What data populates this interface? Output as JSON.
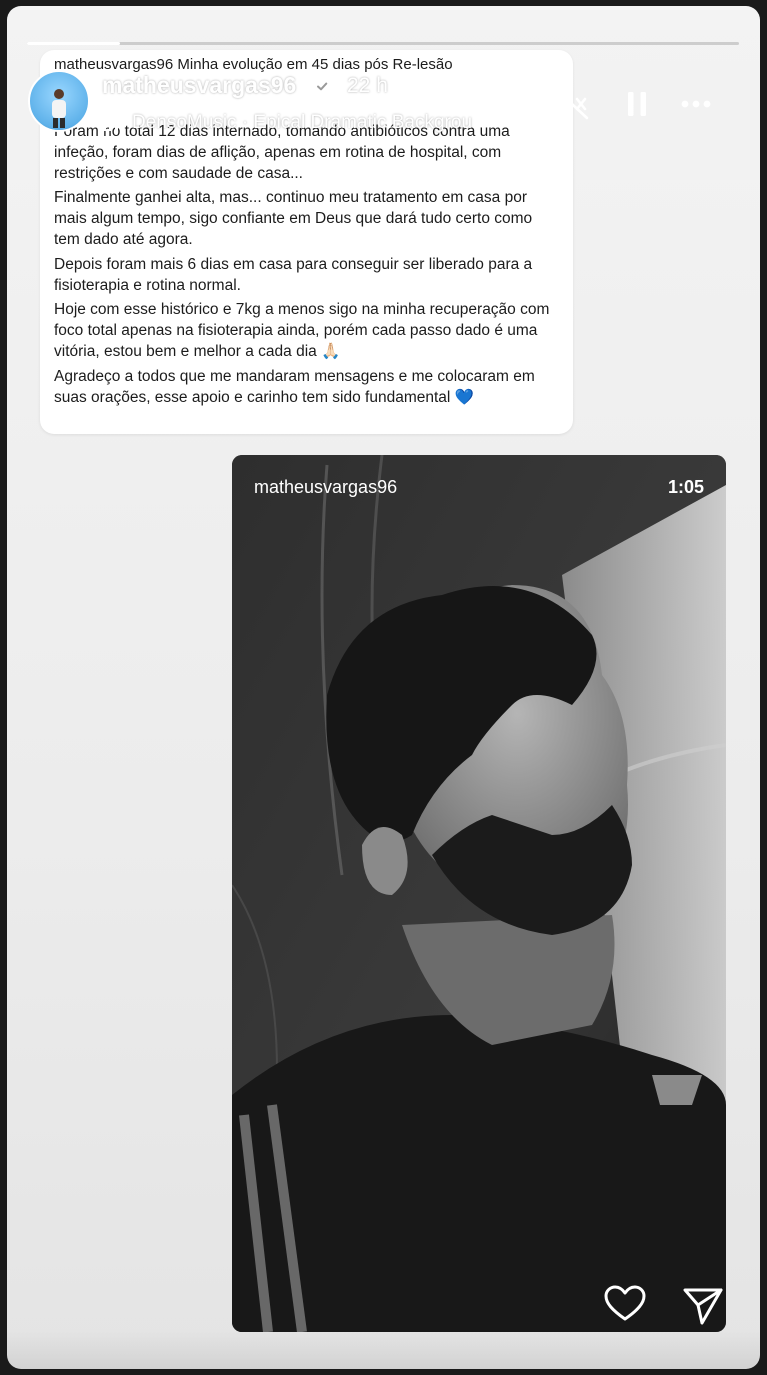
{
  "story": {
    "username": "matheusvargas96",
    "time_ago": "22 h",
    "music_track": "DensoMusic · Epical Dramatic Backgrou",
    "progress": 0.13
  },
  "caption": {
    "header_username": "matheusvargas96",
    "header_text": "Minha evolução em 45 dias pós Re-lesão",
    "paragraphs": [
      "Foram no total 12 dias internado, tomando antibióticos contra uma infeção, foram dias de aflição, apenas em rotina de hospital, com restrições e com saudade de casa...",
      "Finalmente ganhei alta, mas...  continuo meu tratamento em casa por mais algum tempo, sigo confiante em Deus que dará tudo certo como tem dado até agora.",
      "Depois foram mais 6 dias em casa para conseguir ser liberado para a fisioterapia e rotina normal.",
      "Hoje com esse histórico e 7kg a menos sigo na minha recuperação com foco total apenas na fisioterapia ainda, porém cada passo dado é uma vitória, estou bem e melhor a cada dia 🙏🏻",
      "Agradeço a todos que me mandaram mensagens e me colocaram em suas orações, esse apoio e carinho tem sido fundamental"
    ],
    "end_emoji": "💙"
  },
  "video": {
    "username": "matheusvargas96",
    "duration": "1:05"
  },
  "icons": {
    "mute": "speaker-muted-icon",
    "pause": "pause-icon",
    "more": "more-icon",
    "verified": "verified-badge-icon",
    "music": "music-bars-icon",
    "like": "heart-icon",
    "share": "send-icon"
  },
  "colors": {
    "verified": "#ffffff",
    "accent_heart": "#2b6fd8"
  }
}
